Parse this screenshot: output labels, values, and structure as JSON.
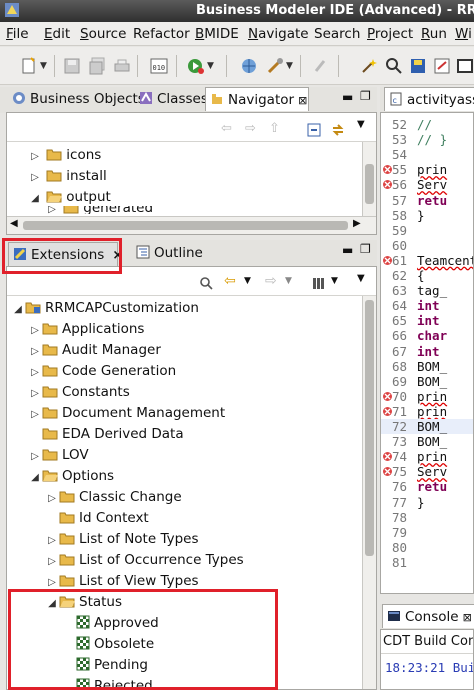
{
  "window": {
    "title": "Business Modeler IDE (Advanced) - RRM"
  },
  "menu": [
    {
      "mn": "F",
      "rest": "ile"
    },
    {
      "mn": "E",
      "rest": "dit"
    },
    {
      "mn": "S",
      "rest": "ource"
    },
    {
      "mn": "",
      "rest": "Refactor"
    },
    {
      "mn": "B",
      "rest": "MIDE"
    },
    {
      "mn": "N",
      "rest": "avigate"
    },
    {
      "mn": "",
      "rest": "Search"
    },
    {
      "mn": "P",
      "rest": "roject"
    },
    {
      "mn": "R",
      "rest": "un"
    },
    {
      "mn": "W",
      "rest": "i"
    }
  ],
  "navigator_view": {
    "tabs": [
      "Business Objects",
      "Classes",
      "Navigator"
    ],
    "items": [
      "icons",
      "install",
      "output",
      "generated"
    ]
  },
  "extensions_view": {
    "tabs": [
      "Extensions",
      "Outline"
    ],
    "close_glyph": "×",
    "tree": [
      {
        "label": "RRMCAPCustomization",
        "depth": 0,
        "toggle": "open",
        "icon": "project"
      },
      {
        "label": "Applications",
        "depth": 1,
        "toggle": "closed",
        "icon": "folder"
      },
      {
        "label": "Audit Manager",
        "depth": 1,
        "toggle": "closed",
        "icon": "folder"
      },
      {
        "label": "Code Generation",
        "depth": 1,
        "toggle": "closed",
        "icon": "folder"
      },
      {
        "label": "Constants",
        "depth": 1,
        "toggle": "closed",
        "icon": "folder"
      },
      {
        "label": "Document Management",
        "depth": 1,
        "toggle": "closed",
        "icon": "folder"
      },
      {
        "label": "EDA Derived Data",
        "depth": 1,
        "toggle": "none",
        "icon": "folder"
      },
      {
        "label": "LOV",
        "depth": 1,
        "toggle": "closed",
        "icon": "folder"
      },
      {
        "label": "Options",
        "depth": 1,
        "toggle": "open",
        "icon": "folder"
      },
      {
        "label": "Classic Change",
        "depth": 2,
        "toggle": "closed",
        "icon": "folder"
      },
      {
        "label": "Id Context",
        "depth": 2,
        "toggle": "none",
        "icon": "folder"
      },
      {
        "label": "List of Note Types",
        "depth": 2,
        "toggle": "closed",
        "icon": "folder"
      },
      {
        "label": "List of Occurrence Types",
        "depth": 2,
        "toggle": "closed",
        "icon": "folder"
      },
      {
        "label": "List of View Types",
        "depth": 2,
        "toggle": "closed",
        "icon": "folder"
      },
      {
        "label": "Status",
        "depth": 2,
        "toggle": "open",
        "icon": "folder"
      },
      {
        "label": "Approved",
        "depth": 3,
        "toggle": "none",
        "icon": "status"
      },
      {
        "label": "Obsolete",
        "depth": 3,
        "toggle": "none",
        "icon": "status"
      },
      {
        "label": "Pending",
        "depth": 3,
        "toggle": "none",
        "icon": "status"
      },
      {
        "label": "Rejected",
        "depth": 3,
        "toggle": "none",
        "icon": "status"
      }
    ]
  },
  "editor": {
    "tab": "activityassi",
    "lines": [
      {
        "n": "52",
        "text": "//",
        "style": "cm",
        "marker": false
      },
      {
        "n": "53",
        "text": "//  }",
        "style": "cm",
        "marker": false
      },
      {
        "n": "54",
        "text": "",
        "style": "",
        "marker": false
      },
      {
        "n": "55",
        "text": "    prin",
        "style": "err",
        "marker": true
      },
      {
        "n": "56",
        "text": "    Serv",
        "style": "err",
        "marker": true
      },
      {
        "n": "57",
        "text": "    retu",
        "style": "kw",
        "marker": false
      },
      {
        "n": "58",
        "text": "}",
        "style": "",
        "marker": false
      },
      {
        "n": "59",
        "text": "",
        "style": "",
        "marker": false
      },
      {
        "n": "60",
        "text": "",
        "style": "",
        "marker": false
      },
      {
        "n": "61",
        "text": "Teamcent",
        "style": "err",
        "marker": true
      },
      {
        "n": "62",
        "text": "{",
        "style": "",
        "marker": false
      },
      {
        "n": "63",
        "text": "    tag_",
        "style": "",
        "marker": false
      },
      {
        "n": "64",
        "text": "    int",
        "style": "kw",
        "marker": false
      },
      {
        "n": "65",
        "text": "    int",
        "style": "kw",
        "marker": false
      },
      {
        "n": "66",
        "text": "    char",
        "style": "kw",
        "marker": false
      },
      {
        "n": "67",
        "text": "    int",
        "style": "kw",
        "marker": false
      },
      {
        "n": "68",
        "text": "    BOM_",
        "style": "",
        "marker": false
      },
      {
        "n": "69",
        "text": "    BOM_",
        "style": "",
        "marker": false
      },
      {
        "n": "70",
        "text": "    prin",
        "style": "err",
        "marker": true
      },
      {
        "n": "71",
        "text": "    prin",
        "style": "err",
        "marker": true
      },
      {
        "n": "72",
        "text": "    BOM_",
        "style": "",
        "marker": false
      },
      {
        "n": "73",
        "text": "    BOM_",
        "style": "",
        "marker": false
      },
      {
        "n": "74",
        "text": "    prin",
        "style": "err",
        "marker": true
      },
      {
        "n": "75",
        "text": "    Serv",
        "style": "err",
        "marker": true
      },
      {
        "n": "76",
        "text": "    retu",
        "style": "kw",
        "marker": false
      },
      {
        "n": "77",
        "text": "}",
        "style": "",
        "marker": false
      },
      {
        "n": "78",
        "text": "",
        "style": "",
        "marker": false
      },
      {
        "n": "79",
        "text": "",
        "style": "",
        "marker": false
      },
      {
        "n": "80",
        "text": "",
        "style": "",
        "marker": false
      },
      {
        "n": "81",
        "text": "",
        "style": "",
        "marker": false
      }
    ]
  },
  "console": {
    "tab": "Console",
    "header": "CDT Build Cons",
    "line": "18:23:21 Bui"
  },
  "colors": {
    "highlight": "#e0202a",
    "folder": "#e8b94a",
    "title_bar": "#3a3a3a"
  }
}
